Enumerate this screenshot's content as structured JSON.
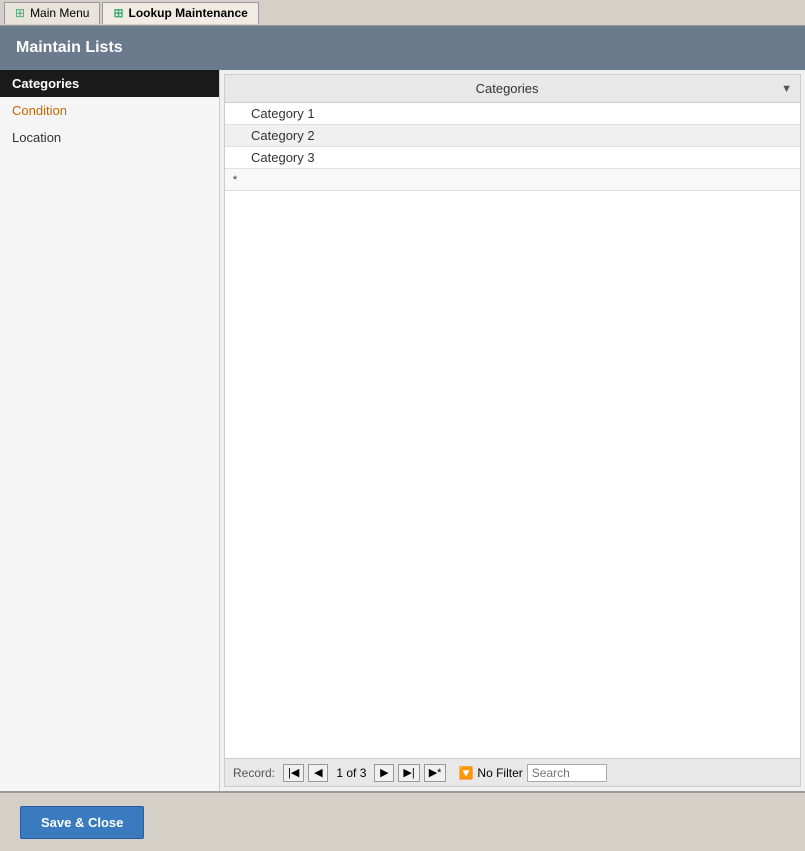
{
  "tabs": [
    {
      "label": "Main Menu",
      "active": false,
      "icon": "home-icon"
    },
    {
      "label": "Lookup Maintenance",
      "active": true,
      "icon": "grid-icon"
    }
  ],
  "title": "Maintain Lists",
  "sidebar": {
    "items": [
      {
        "label": "Categories",
        "selected": true,
        "style": "selected"
      },
      {
        "label": "Condition",
        "style": "condition"
      },
      {
        "label": "Location",
        "style": "location"
      }
    ]
  },
  "grid": {
    "header": "Categories",
    "header_arrow": "▼",
    "rows": [
      {
        "value": "Category 1",
        "indicator": ""
      },
      {
        "value": "Category 2",
        "indicator": ""
      },
      {
        "value": "Category 3",
        "indicator": ""
      }
    ],
    "new_row_indicator": "*"
  },
  "navigation": {
    "record_label": "Record:",
    "current_record": "1 of 3",
    "no_filter": "No Filter",
    "search_placeholder": "Search"
  },
  "bottom": {
    "save_close_label": "Save & Close"
  }
}
